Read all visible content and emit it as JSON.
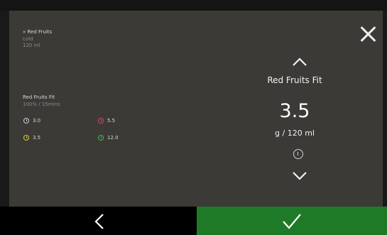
{
  "recipe": {
    "title": "» Red Fruits",
    "temperature": "cold",
    "volume": "120 ml"
  },
  "ingredient": {
    "name": "Red Fruits Fit",
    "detail": "100%  /  15mins",
    "doses": [
      {
        "value": "3.0",
        "color": "#cfcfcf"
      },
      {
        "value": "5.5",
        "color": "#d8455f"
      },
      {
        "value": "3.5",
        "color": "#d9c83a"
      },
      {
        "value": "12.0",
        "color": "#45b85a"
      }
    ]
  },
  "selector": {
    "product_name": "Red Fruits Fit",
    "dose_value": "3.5",
    "dose_unit": "g / 120 ml"
  },
  "icons": {
    "close": "close-icon",
    "up": "chevron-up-icon",
    "down": "chevron-down-icon",
    "info": "info-icon",
    "back": "chevron-left-icon",
    "confirm": "checkmark-icon"
  },
  "colors": {
    "panel": "#3c3a37",
    "confirm": "#1f7a28",
    "back": "#000000"
  }
}
